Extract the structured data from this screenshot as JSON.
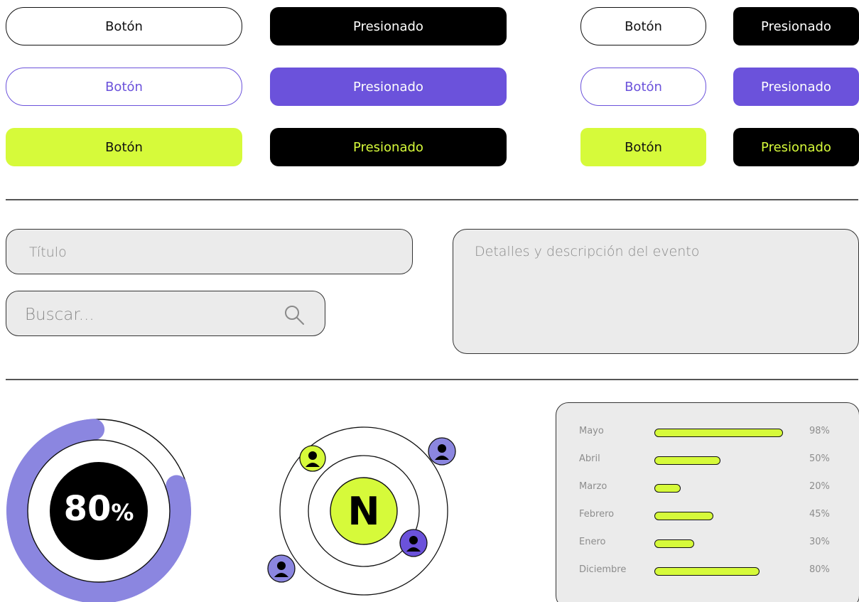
{
  "buttons": {
    "default_label": "Botón",
    "pressed_label": "Presionado"
  },
  "inputs": {
    "title_placeholder": "Título",
    "search_placeholder": "Buscar...",
    "details_placeholder": "Detalles y descripción del evento"
  },
  "progress": {
    "value_number": "80",
    "value_suffix": "%",
    "fraction": 0.8
  },
  "network": {
    "center_letter": "N"
  },
  "colors": {
    "purple": "#6b52db",
    "lavender": "#8b86e0",
    "lime": "#d6fa3a",
    "black": "#000000",
    "field_gray": "#ebebeb"
  },
  "chart_data": {
    "type": "bar",
    "orientation": "horizontal",
    "categories": [
      "Mayo",
      "Abril",
      "Marzo",
      "Febrero",
      "Enero",
      "Diciembre"
    ],
    "values": [
      98,
      50,
      20,
      45,
      30,
      80
    ],
    "labels": [
      "98%",
      "50%",
      "20%",
      "45%",
      "30%",
      "80%"
    ],
    "xlim": [
      0,
      100
    ]
  }
}
